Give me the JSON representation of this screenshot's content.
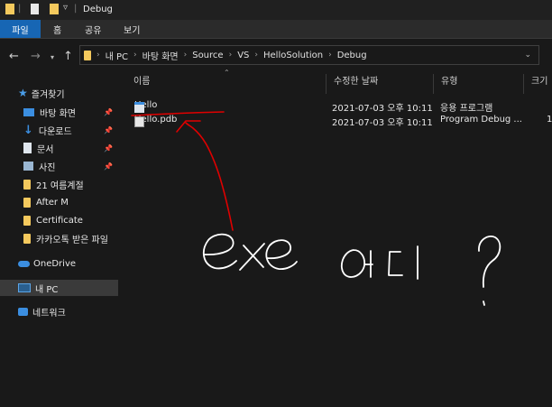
{
  "window": {
    "title": "Debug"
  },
  "ribbon": {
    "tabs": [
      "파일",
      "홈",
      "공유",
      "보기"
    ]
  },
  "address": {
    "crumbs": [
      "내 PC",
      "바탕 화면",
      "Source",
      "VS",
      "HelloSolution",
      "Debug"
    ]
  },
  "sidebar": {
    "quick_access": "즐겨찾기",
    "items": [
      {
        "label": "바탕 화면",
        "pinned": true
      },
      {
        "label": "다운로드",
        "pinned": true
      },
      {
        "label": "문서",
        "pinned": true
      },
      {
        "label": "사진",
        "pinned": true
      },
      {
        "label": "21 여름계절",
        "pinned": false
      },
      {
        "label": "After M",
        "pinned": false
      },
      {
        "label": "Certificate",
        "pinned": false
      },
      {
        "label": "카카오톡 받은 파일",
        "pinned": false
      }
    ],
    "onedrive": "OneDrive",
    "this_pc": "내 PC",
    "network": "네트워크"
  },
  "columns": {
    "name": "이름",
    "date": "수정한 날짜",
    "type": "유형",
    "size": "크기"
  },
  "files": [
    {
      "name": "Hello",
      "date": "2021-07-03 오후 10:11",
      "type": "응용 프로그램",
      "size": ""
    },
    {
      "name": "Hello.pdb",
      "date": "2021-07-03 오후 10:11",
      "type": "Program Debug ...",
      "size": "1"
    }
  ],
  "annotation": {
    "handwritten_text": "exe 어디?",
    "color": "#e00000"
  }
}
